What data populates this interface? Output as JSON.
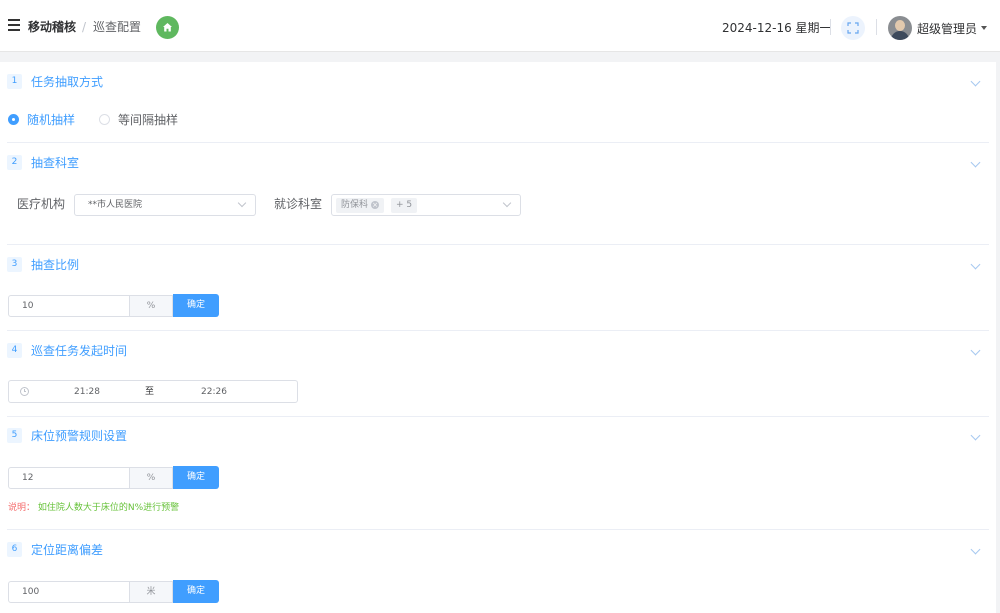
{
  "header": {
    "breadcrumb_root": "移动稽核",
    "breadcrumb_sep": "/",
    "breadcrumb_current": "巡查配置",
    "date": "2024-12-16 星期一",
    "user_name": "超级管理员"
  },
  "colors": {
    "primary": "#409eff",
    "home_button": "#5fb85f",
    "note_key": "#f56c6c",
    "note_value": "#67c23a"
  },
  "icons": {
    "menu": "hamburger-icon",
    "home": "home-icon",
    "fullscreen": "fullscreen-icon",
    "user_menu": "caret-down-icon",
    "collapse": "chevron-down-icon",
    "time": "clock-icon"
  },
  "sections": {
    "s1": {
      "no": "1",
      "title": "任务抽取方式",
      "options": [
        "随机抽样",
        "等间隔抽样"
      ],
      "selected": "随机抽样"
    },
    "s2": {
      "no": "2",
      "title": "抽查科室",
      "org_label": "医疗机构",
      "org_value": "**市人民医院",
      "dept_label": "就诊科室",
      "dept_tag": "防保科",
      "dept_more": "+ 5"
    },
    "s3": {
      "no": "3",
      "title": "抽查比例",
      "value": "10",
      "unit": "%",
      "confirm": "确定"
    },
    "s4": {
      "no": "4",
      "title": "巡查任务发起时间",
      "start": "21:28",
      "sep": "至",
      "end": "22:26"
    },
    "s5": {
      "no": "5",
      "title": "床位预警规则设置",
      "value": "12",
      "unit": "%",
      "confirm": "确定",
      "note_key": "说明：",
      "note_value": "如住院人数大于床位的N%进行预警"
    },
    "s6": {
      "no": "6",
      "title": "定位距离偏差",
      "value": "100",
      "unit": "米",
      "confirm": "确定"
    }
  }
}
